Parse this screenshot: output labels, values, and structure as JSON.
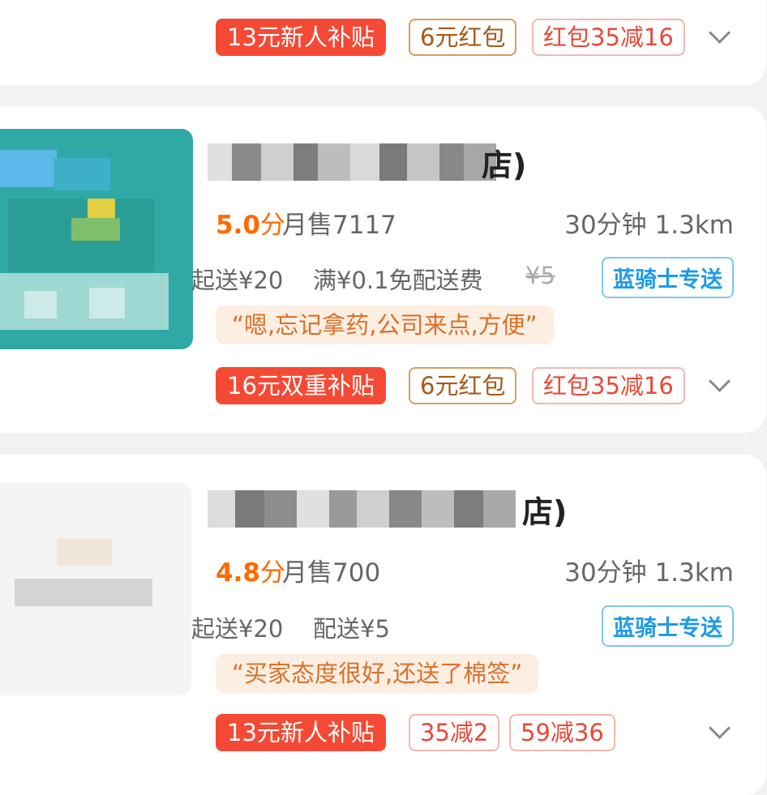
{
  "stores": [
    {
      "id_label": "store-1",
      "tags": [
        "13元新人补贴",
        "6元红包",
        "红包35减16"
      ]
    },
    {
      "id_label": "store-2",
      "name_suffix": "店)",
      "score": "5.0",
      "score_unit": "分",
      "monthly_sales": "月售7117",
      "time_distance": "30分钟 1.3km",
      "min_order": "起送¥20",
      "delivery_fee": "满¥0.1免配送费",
      "original_fee": "¥5",
      "delivery_badge": "蓝骑士专送",
      "review": "“嗯,忘记拿药,公司来点,方便”",
      "tags": [
        "16元双重补贴",
        "6元红包",
        "红包35减16"
      ]
    },
    {
      "id_label": "store-3",
      "name_suffix": "店)",
      "score": "4.8",
      "score_unit": "分",
      "monthly_sales": "月售700",
      "time_distance": "30分钟 1.3km",
      "min_order": "起送¥20",
      "delivery_fee": "配送¥5",
      "delivery_badge": "蓝骑士专送",
      "review": "“买家态度很好,还送了棉签”",
      "tags": [
        "13元新人补贴",
        "35减2",
        "59减36"
      ]
    }
  ],
  "colors": {
    "accent_orange": "#ff6a00",
    "subsidy_red": "#f44a35",
    "delivery_blue": "#1e9be6",
    "review_bg": "#fdeee2"
  },
  "icons": [
    "chevron-down-icon"
  ]
}
